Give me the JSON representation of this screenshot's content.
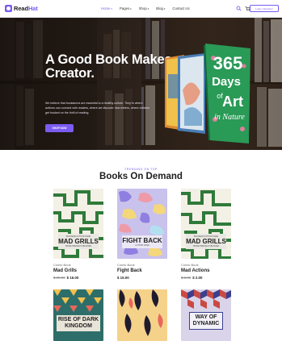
{
  "brand": {
    "name_a": "Read",
    "name_b": "Hat"
  },
  "nav": [
    {
      "label": "Home",
      "dropdown": true,
      "active": true
    },
    {
      "label": "Pages",
      "dropdown": true
    },
    {
      "label": "Shop",
      "dropdown": true
    },
    {
      "label": "Blog",
      "dropdown": true
    },
    {
      "label": "Contact Us",
      "dropdown": false
    }
  ],
  "header": {
    "login_label": "Login / Register",
    "icons": [
      "search-icon",
      "cart-icon"
    ]
  },
  "hero": {
    "title": "A Good Book Makes Creator.",
    "description": "We believe that bookstores are essential to a healthy culture. They're where authors can connect with readers, where we discover new writers, where children get hooked on the thrill of reading.",
    "button_label": "SHOP NOW",
    "featured_book": {
      "line1": "365",
      "line2": "Days",
      "line3": "of",
      "line4": "Art",
      "line5": "in Nature"
    }
  },
  "section": {
    "eyebrow": "TRENDING ON TOP",
    "title": "Books On Demand"
  },
  "products": [
    {
      "category": "Comic Book",
      "title": "Mad Grills",
      "old_price": "$ 29.00",
      "price": "$ 16.00",
      "cover_title": "MAD GRILLS",
      "cover_top": "BOLDIEAR AUTHOR NAME",
      "cover_sub": "PRIME PRESSE PUBLISHER"
    },
    {
      "category": "Comic Book",
      "title": "Fight Back",
      "old_price": "",
      "price": "$ 15.00",
      "cover_title": "FIGHT BACK",
      "cover_top": "",
      "cover_sub": "AUTHOR NAME"
    },
    {
      "category": "Comic Book",
      "title": "Mad Actions",
      "old_price": "$ 3.00",
      "price": "$ 2.00",
      "cover_title": "MAD GRILLS",
      "cover_top": "BOLDIEAR AUTHOR NAME",
      "cover_sub": "PRIME PRESSE PUBLISHER"
    }
  ],
  "products_row2": [
    {
      "cover_title_1": "RISE OF DARK",
      "cover_title_2": "KINGDOM"
    },
    {
      "cover_title_1": "",
      "cover_title_2": ""
    },
    {
      "cover_title_1": "WAY OF",
      "cover_title_2": "DYNAMIC"
    }
  ],
  "colors": {
    "accent": "#7b5cf0",
    "text": "#1d1d1d",
    "muted": "#888888"
  }
}
